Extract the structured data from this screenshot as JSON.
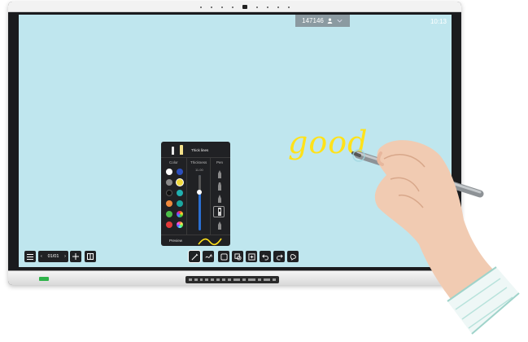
{
  "screen": {
    "user_tab": {
      "label": "147146",
      "icon": "user-icon",
      "chevron": "chevron-down-icon"
    },
    "clock": "10:13",
    "handwriting": "good",
    "handwriting_color": "#ffe21a",
    "background_color": "#bfe6ee"
  },
  "pen_panel": {
    "title": "Thick lines",
    "color_header": "Color",
    "thickness_header": "Thickness",
    "pen_header": "Pen",
    "thickness_value": "11.00",
    "preview_label": "Preview",
    "colors": [
      "#ffffff",
      "#2c4fbd",
      "#8a8a8a",
      "#f1d93c",
      "#111111",
      "#21b0b0",
      "#f08a3c",
      "#1ba7a0",
      "#4cc04a",
      "#multicolor",
      "#e23a3a",
      "#colorwheel"
    ],
    "pen_styles": [
      "pencil-tip-icon",
      "marker-tip-icon",
      "brush-tip-icon",
      "highlighter-tip-icon",
      "calligraphy-tip-icon"
    ],
    "selected_pen": "highlighter-tip-icon"
  },
  "toolbar": {
    "menu_icon": "menu-icon",
    "page_indicator": "01/01",
    "prev_icon": "chevron-left-icon",
    "next_icon": "chevron-right-icon",
    "add_page_icon": "plus-icon",
    "page_view_icon": "page-view-icon",
    "tools": [
      "pen-icon",
      "eraser-icon",
      "select-icon",
      "shapes-icon",
      "insert-icon",
      "undo-icon",
      "redo-icon",
      "clear-icon"
    ]
  }
}
